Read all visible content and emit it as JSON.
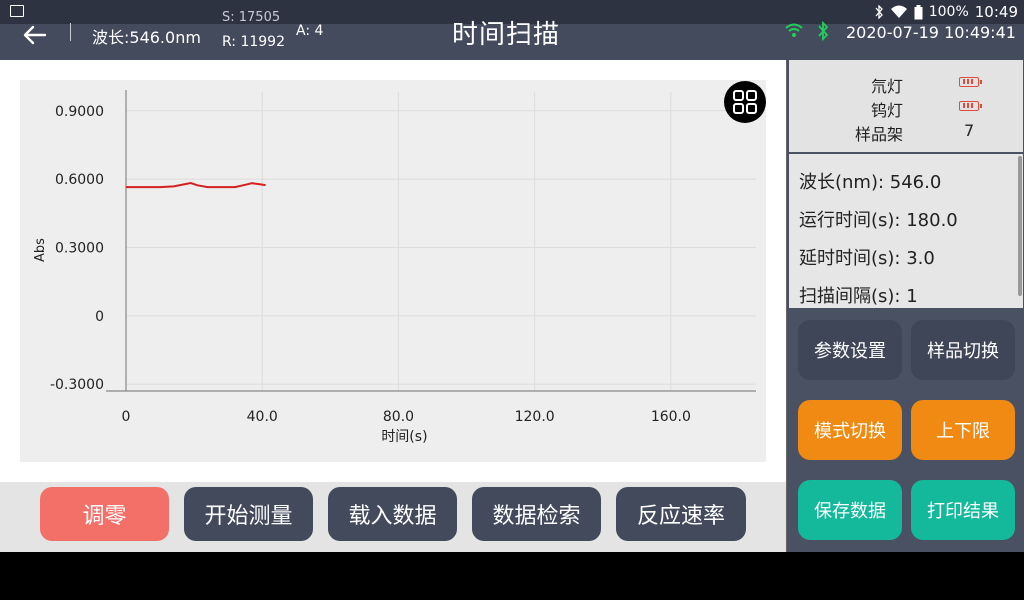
{
  "statusbar": {
    "battery": "100%",
    "time": "10:49"
  },
  "header": {
    "wavelength": "波长:546.0nm",
    "s_value": "S: 17505",
    "r_value": "R: 11992",
    "a_value": "A: 4",
    "title": "时间扫描",
    "datetime": "2020-07-19 10:49:41"
  },
  "chart_data": {
    "type": "line",
    "xlabel": "时间(s)",
    "ylabel": "Abs",
    "xlim": [
      0,
      185
    ],
    "ylim": [
      -0.33,
      1.0
    ],
    "x_ticks": [
      0,
      40,
      80,
      120,
      160
    ],
    "x_tick_labels": [
      "0",
      "40.0",
      "80.0",
      "120.0",
      "160.0"
    ],
    "y_ticks": [
      -0.3,
      0,
      0.3,
      0.6,
      0.9
    ],
    "y_tick_labels": [
      "-0.3000",
      "0",
      "0.3000",
      "0.6000",
      "0.9000"
    ],
    "grid": true,
    "series": [
      {
        "color": "#d42020",
        "x": [
          0,
          5,
          10,
          14,
          17,
          19,
          21,
          24,
          28,
          32,
          35,
          37,
          39,
          41
        ],
        "y": [
          0.565,
          0.565,
          0.565,
          0.568,
          0.577,
          0.583,
          0.573,
          0.565,
          0.565,
          0.565,
          0.575,
          0.582,
          0.578,
          0.574
        ]
      }
    ]
  },
  "bottom_buttons": [
    "调零",
    "开始测量",
    "载入数据",
    "数据检索",
    "反应速率"
  ],
  "side": {
    "status": [
      {
        "label": "氘灯"
      },
      {
        "label": "钨灯"
      },
      {
        "label": "样品架",
        "value": "7"
      }
    ],
    "params": [
      "波长(nm): 546.0",
      "运行时间(s): 180.0",
      "延时时间(s): 3.0",
      "扫描间隔(s): 1"
    ],
    "buttons": [
      "参数设置",
      "样品切换",
      "模式切换",
      "上下限",
      "保存数据",
      "打印结果"
    ]
  },
  "colors": {
    "accent_orange": "#f08a12",
    "accent_teal": "#14b89a",
    "zero_button": "#f37068"
  }
}
